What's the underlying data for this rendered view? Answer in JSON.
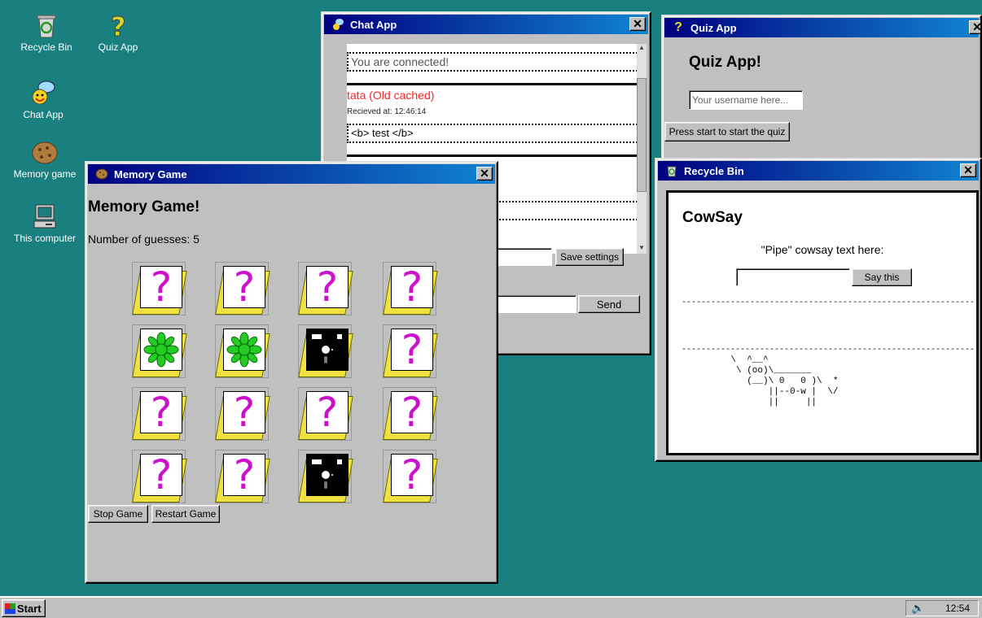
{
  "desktop": {
    "icons": [
      {
        "label": "Recycle Bin",
        "icon": "recycle-bin-icon"
      },
      {
        "label": "Quiz App",
        "icon": "question-mark-icon"
      },
      {
        "label": "Chat App",
        "icon": "chat-bubble-icon"
      },
      {
        "label": "Memory game",
        "icon": "cookie-icon"
      },
      {
        "label": "This computer",
        "icon": "computer-icon"
      }
    ]
  },
  "chat": {
    "title": "Chat App",
    "messages": [
      {
        "text": "You are connected!"
      },
      {
        "author": "tata (Old cached)",
        "received": "Recieved at: 12:46:14",
        "text": "<b> test </b>"
      }
    ],
    "save_settings_label": "Save settings",
    "send_label": "Send"
  },
  "quiz": {
    "title": "Quiz App",
    "heading": "Quiz App!",
    "username_placeholder": "Your username here...",
    "start_label": "Press start to start the quiz"
  },
  "memory": {
    "title": "Memory Game",
    "heading": "Memory Game!",
    "guesses_text": "Number of guesses: 5",
    "cards": [
      "question",
      "question",
      "question",
      "question",
      "flower",
      "flower",
      "floppy",
      "question",
      "question",
      "question",
      "question",
      "question",
      "question",
      "question",
      "floppy",
      "question"
    ],
    "stop_label": "Stop Game",
    "restart_label": "Restart Game"
  },
  "recycle": {
    "title": "Recycle Bin",
    "heading": "CowSay",
    "prompt": "\"Pipe\" cowsay text here:",
    "say_label": "Say this",
    "separator": "------------------------------------------------------------",
    "cow": "    \\  ^__^\n     \\ (oo)\\_______\n       (__)\\ 0   0 )\\  *\n           ||--0-w |  \\/\n           ||     ||"
  },
  "taskbar": {
    "start_label": "Start",
    "clock": "12:54"
  },
  "colors": {
    "desktop": "#1a7f7f",
    "title_start": "#000080",
    "title_end": "#1084d0",
    "card_question": "#cc11cc",
    "card_flower": "#22cc22",
    "chat_author": "#ff2222"
  }
}
